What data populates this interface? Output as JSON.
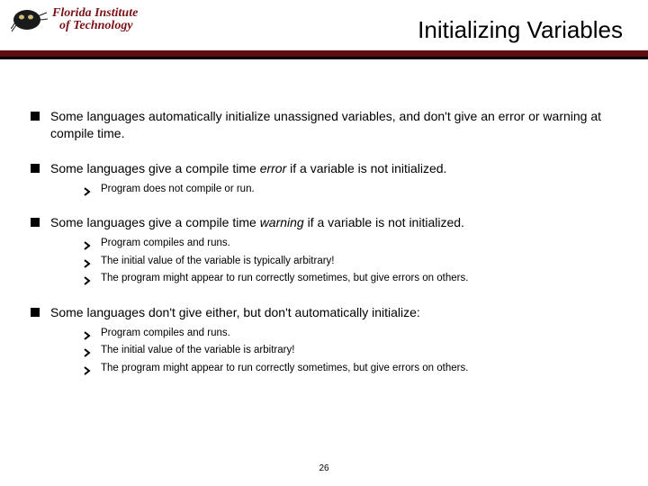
{
  "logo": {
    "line1": "Florida Institute",
    "line2": "of Technology"
  },
  "title": "Initializing Variables",
  "bullets": [
    {
      "text_pre": "Some languages automatically initialize unassigned variables, and don't give an error or warning at compile time.",
      "subs": []
    },
    {
      "text_pre": "Some languages give a compile time ",
      "italic": "error",
      "text_post": " if a variable is not initialized.",
      "subs": [
        "Program does not compile or run."
      ]
    },
    {
      "text_pre": "Some languages give a compile time ",
      "italic": "warning",
      "text_post": " if a variable is not initialized.",
      "subs": [
        "Program compiles and runs.",
        "The initial value of the variable is typically arbitrary!",
        "The program might appear to run correctly sometimes, but give errors on others."
      ]
    },
    {
      "text_pre": "Some languages don't give either, but don't automatically initialize:",
      "subs": [
        "Program compiles and runs.",
        "The initial value of the variable is arbitrary!",
        "The program might appear to run correctly sometimes, but give errors on others."
      ]
    }
  ],
  "page_number": "26",
  "colors": {
    "maroon": "#7a1216",
    "rule_dark": "#5e0e10"
  }
}
